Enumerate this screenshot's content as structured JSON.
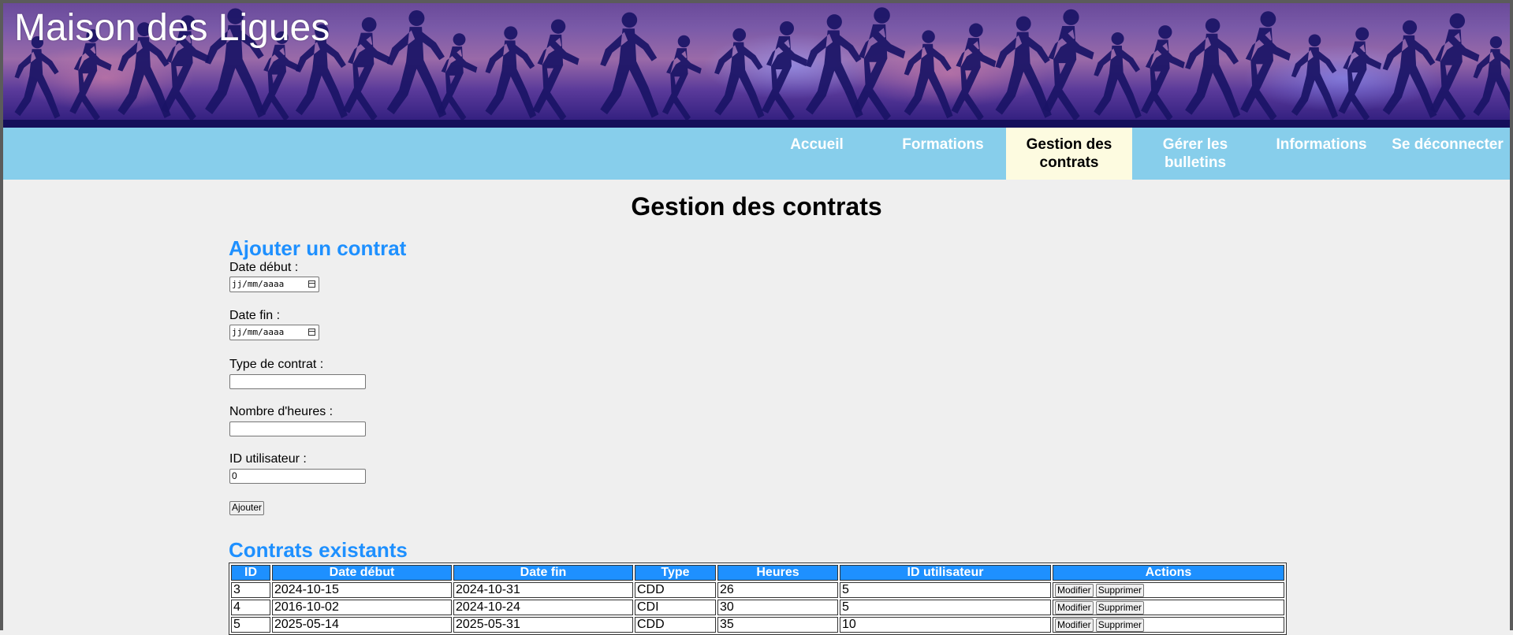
{
  "site": {
    "title": "Maison des Ligues"
  },
  "nav": {
    "items": [
      {
        "label": "Accueil",
        "active": false
      },
      {
        "label": "Formations",
        "active": false
      },
      {
        "label": "Gestion des contrats",
        "active": true
      },
      {
        "label": "Gérer les bulletins",
        "active": false
      },
      {
        "label": "Informations",
        "active": false
      },
      {
        "label": "Se déconnecter",
        "active": false
      }
    ]
  },
  "page": {
    "title": "Gestion des contrats"
  },
  "form": {
    "title": "Ajouter un contrat",
    "date_debut_label": "Date début :",
    "date_debut_placeholder": "jj/mm/aaaa",
    "date_fin_label": "Date fin :",
    "date_fin_placeholder": "jj/mm/aaaa",
    "type_label": "Type de contrat :",
    "type_value": "",
    "heures_label": "Nombre d'heures :",
    "heures_value": "",
    "id_user_label": "ID utilisateur :",
    "id_user_value": "0",
    "submit_label": "Ajouter"
  },
  "list": {
    "title": "Contrats existants",
    "headers": [
      "ID",
      "Date début",
      "Date fin",
      "Type",
      "Heures",
      "ID utilisateur",
      "Actions"
    ],
    "rows": [
      {
        "id": "3",
        "date_debut": "2024-10-15",
        "date_fin": "2024-10-31",
        "type": "CDD",
        "heures": "26",
        "id_user": "5"
      },
      {
        "id": "4",
        "date_debut": "2016-10-02",
        "date_fin": "2024-10-24",
        "type": "CDI",
        "heures": "30",
        "id_user": "5"
      },
      {
        "id": "5",
        "date_debut": "2025-05-14",
        "date_fin": "2025-05-31",
        "type": "CDD",
        "heures": "35",
        "id_user": "10"
      }
    ],
    "modify_label": "Modifier",
    "delete_label": "Supprimer"
  },
  "colors": {
    "nav_bg": "#87ceeb",
    "nav_active_bg": "#fdfbe0",
    "section_title": "#1e90ff",
    "table_header_bg": "#1e90ff"
  }
}
